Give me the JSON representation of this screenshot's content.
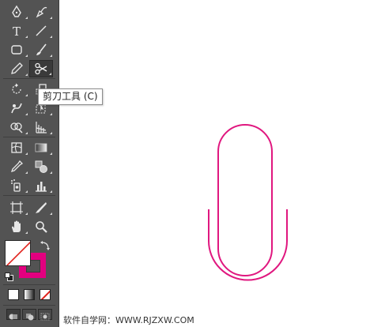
{
  "toolbar": {
    "tools": [
      {
        "name": "pen-tool",
        "icon": "pen-icon"
      },
      {
        "name": "curvature-tool",
        "icon": "curvature-pen-icon"
      },
      {
        "name": "type-tool",
        "icon": "type-icon",
        "glyph": "T"
      },
      {
        "name": "line-segment-tool",
        "icon": "line-icon"
      },
      {
        "name": "rectangle-tool",
        "icon": "rounded-rectangle-icon"
      },
      {
        "name": "paintbrush-tool",
        "icon": "brush-icon"
      },
      {
        "name": "pencil-tool",
        "icon": "pencil-icon"
      },
      {
        "name": "scissors-tool",
        "icon": "scissors-icon"
      },
      {
        "name": "rotate-tool",
        "icon": "rotate-icon"
      },
      {
        "name": "scale-tool",
        "icon": "scale-icon"
      },
      {
        "name": "warp-tool",
        "icon": "warp-icon"
      },
      {
        "name": "free-transform-tool",
        "icon": "free-transform-icon"
      },
      {
        "name": "shape-builder-tool",
        "icon": "shape-builder-icon"
      },
      {
        "name": "perspective-grid-tool",
        "icon": "perspective-grid-icon"
      },
      {
        "name": "mesh-tool",
        "icon": "mesh-icon"
      },
      {
        "name": "gradient-tool",
        "icon": "gradient-icon"
      },
      {
        "name": "eyedropper-tool",
        "icon": "eyedropper-icon"
      },
      {
        "name": "blend-tool",
        "icon": "blend-icon"
      },
      {
        "name": "symbol-sprayer-tool",
        "icon": "symbol-sprayer-icon"
      },
      {
        "name": "column-graph-tool",
        "icon": "column-graph-icon"
      },
      {
        "name": "artboard-tool",
        "icon": "artboard-icon"
      },
      {
        "name": "slice-tool",
        "icon": "slice-icon"
      },
      {
        "name": "hand-tool",
        "icon": "hand-icon"
      },
      {
        "name": "zoom-tool",
        "icon": "zoom-icon"
      }
    ],
    "active_tool": "scissors-tool",
    "fill_color": "#ffffff",
    "stroke_color": "#e2007f",
    "none_indicator_color": "#e0201a"
  },
  "tooltip": {
    "text": "剪刀工具 (C)"
  },
  "canvas": {
    "shape": "paperclip-path",
    "stroke_color": "#e0177f"
  },
  "watermark": {
    "text": "软件自学网：WWW.RJZXW.COM"
  }
}
